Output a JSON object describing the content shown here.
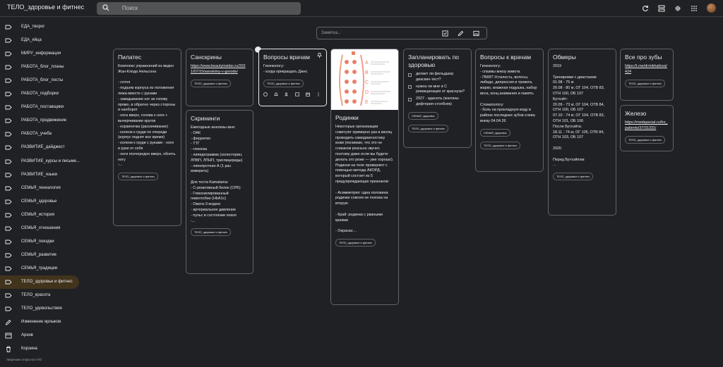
{
  "app": {
    "title": "ТЕЛО_здоровье и фитнес"
  },
  "search": {
    "placeholder": "Поиск"
  },
  "take_note": {
    "placeholder": "Заметка..."
  },
  "sidebar": {
    "items": [
      {
        "label": "ЕДА_творог",
        "icon": "label-icon"
      },
      {
        "label": "ЕДА_яйца",
        "icon": "label-icon"
      },
      {
        "label": "МИРУ_информация",
        "icon": "label-icon"
      },
      {
        "label": "РАБОТА_блог_планы",
        "icon": "label-icon"
      },
      {
        "label": "РАБОТА_блог_посты",
        "icon": "label-icon"
      },
      {
        "label": "РАБОТА_подборки",
        "icon": "label-icon"
      },
      {
        "label": "РАБОТА_поставщики",
        "icon": "label-icon"
      },
      {
        "label": "РАБОТА_продвижение",
        "icon": "label-icon"
      },
      {
        "label": "РАБОТА_учеба",
        "icon": "label-icon"
      },
      {
        "label": "РАЗВИТИЕ_дайджест",
        "icon": "label-icon"
      },
      {
        "label": "РАЗВИТИЕ_курсы и письме...",
        "icon": "label-icon"
      },
      {
        "label": "РАЗВИТИЕ_языки",
        "icon": "label-icon"
      },
      {
        "label": "СЕМЬЯ_генеалогия",
        "icon": "label-icon"
      },
      {
        "label": "СЕМЬЯ_здоровье",
        "icon": "label-icon"
      },
      {
        "label": "СЕМЬЯ_история",
        "icon": "label-icon"
      },
      {
        "label": "СЕМЬЯ_отношения",
        "icon": "label-icon"
      },
      {
        "label": "СЕМЬЯ_поездки",
        "icon": "label-icon"
      },
      {
        "label": "СЕМЬЯ_развитие",
        "icon": "label-icon"
      },
      {
        "label": "СЕМЬЯ_традиции",
        "icon": "label-icon"
      },
      {
        "label": "ТЕЛО_здоровье и фитнес",
        "icon": "label-icon",
        "active": true
      },
      {
        "label": "ТЕЛО_красота",
        "icon": "label-icon"
      },
      {
        "label": "ТЕЛО_удовольствия",
        "icon": "label-icon"
      },
      {
        "label": "Изменение ярлыков",
        "icon": "pencil-icon"
      },
      {
        "label": "Архив",
        "icon": "archive-icon"
      },
      {
        "label": "Корзина",
        "icon": "trash-icon"
      }
    ],
    "license": "Лицензии открытого ПО"
  },
  "cards": {
    "pilates": {
      "title": "Пилатес",
      "body": "Комплекс упражнений из видео Жан-Клода Нельсона\n\n- сотня\n- подъем корпуса из положения лежа вместе с руками\n- закидывание ног за голову прямо, в обратно через стороны и наоборот\n- нога вверх, голова к ноге + вычерчивание кругов\n- корзиночка (раскачивание)\n- колени к груди по очереди (корпус поднят все время)\n- колени к груди с руками - ноги и руки от себя\n- ноги поочередно вверх, обнять ногу\n-...",
      "chip": "ТЕЛО_здоровье и фитнес"
    },
    "sanskriny": {
      "title": "Санскрины",
      "link": "https://www.beautyinsider.ru/2021/07/15/sanskriny-v-gorode/",
      "chip": "ТЕЛО_здоровье и фитнес"
    },
    "skriningi": {
      "title": "Скрининги",
      "body": "Ежегодные анализы мне:\n- ОАК\n- ферритин\n- ТТГ\n- глюкоза\n- липидограмма (холестерин, ЛПВП, ЛПНП, триглицериды)\n- липопротеин А (1 раз измерить)\n\nДля теста Kamalama:\n- С-реактивный белок (СРБ)\n- Гликозилированный гемоглобин (HbA1c)\n- Омега-3 индекс\n- артериальное давление\n- пульс в состоянии покоя\n-...",
      "chip": "ТЕЛО_здоровье и фитнес"
    },
    "voprosy_vracham": {
      "title": "Вопросы врачам",
      "body": "Гинекологу:\n- когда прекращать Джес",
      "chip": "ТЕЛО_здоровье и фитнес"
    },
    "rodinki": {
      "title": "Родинки",
      "image_letters": [
        "A",
        "B",
        "C",
        "D",
        "E"
      ],
      "body": "Некоторые организации советуют примерно раз в месяц проводить самодиагностику кожи (понимаю, что это не слишком реально звучит, поэтому даже если вы будете делать это реже — уже хорошо). Родинки на теле проверяют с помощью метода АКОРД, который состоит из 5 предупреждающих признаков:\n\n- Асимметрия: одна половина родинки совсем не похожа на вторую\n\n- Край: родинка с рваными краями\n\n- Окраска:...",
      "chip": "ТЕЛО_здоровье и фитнес"
    },
    "zaplanirovat": {
      "title": "Запланировать по здоровью",
      "items": [
        "делает ли фельдшер диаскин-тест?",
        "нужна ли мне и С ревакцинация от краснухи?",
        "2027 - адасель (коклюш-дифтерия-столбняк)"
      ],
      "chips": [
        "СЕМЬЯ_здоровье",
        "ТЕЛО_здоровье и фитнес"
      ]
    },
    "voprosy_k_vracham": {
      "title": "Вопросы к врачам",
      "body": "Гинекологу:\n- спазмы внизу живота\n- ПМЯ? Усталость, волосы, либидо, депрессия и тревога, жарко, влажная подушка, набор веса, конц.анимания и память\n\nСтоматологу:\n- боль на прокладную воду в районе последних зубов слева внизу 04.04.26",
      "chips": [
        "СЕМЬЯ_здоровье",
        "ТЕЛО_здоровье и фитнес"
      ]
    },
    "obmery": {
      "title": "Обмеры",
      "body": "2019\n\nТренировки с диастазом:\n01.08 - 75 кг\n26.08 - 80 кг, ОГ 104, ОТВ 83, ОТН 100, ОБ 107\nБутхэйт:\n20.09 - 73 кг, ОГ 104, ОТВ 84, ОТН 100, ОБ 107\n07.10 - 74 кг, ОГ 104, ОТВ 83, ОТН 101, ОБ 106\nПосле Бутхэйта:\n18.11 - 74 кг, ОГ 105, ОТВ 84, ОТН 103, ОБ 107\n\n2020\n\nПеред Бутхэйпом:\n...",
      "chip": "ТЕЛО_здоровье и фитнес"
    },
    "pro_zuby": {
      "title": "Все про зубы",
      "link": "https://t.me/drmikhailova/424",
      "chip": "ТЕЛО_здоровье и фитнес"
    },
    "zhelezo": {
      "title": "Железо",
      "link": "https://medspecial.ru/for_patients/37/31331/",
      "chip": "ТЕЛО_здоровье и фитнес"
    }
  },
  "colors": {
    "background": "#202124",
    "card_border": "#5f6368",
    "active_label_bg": "#41331c",
    "search_bg": "#525355",
    "text": "#e8eaed"
  }
}
